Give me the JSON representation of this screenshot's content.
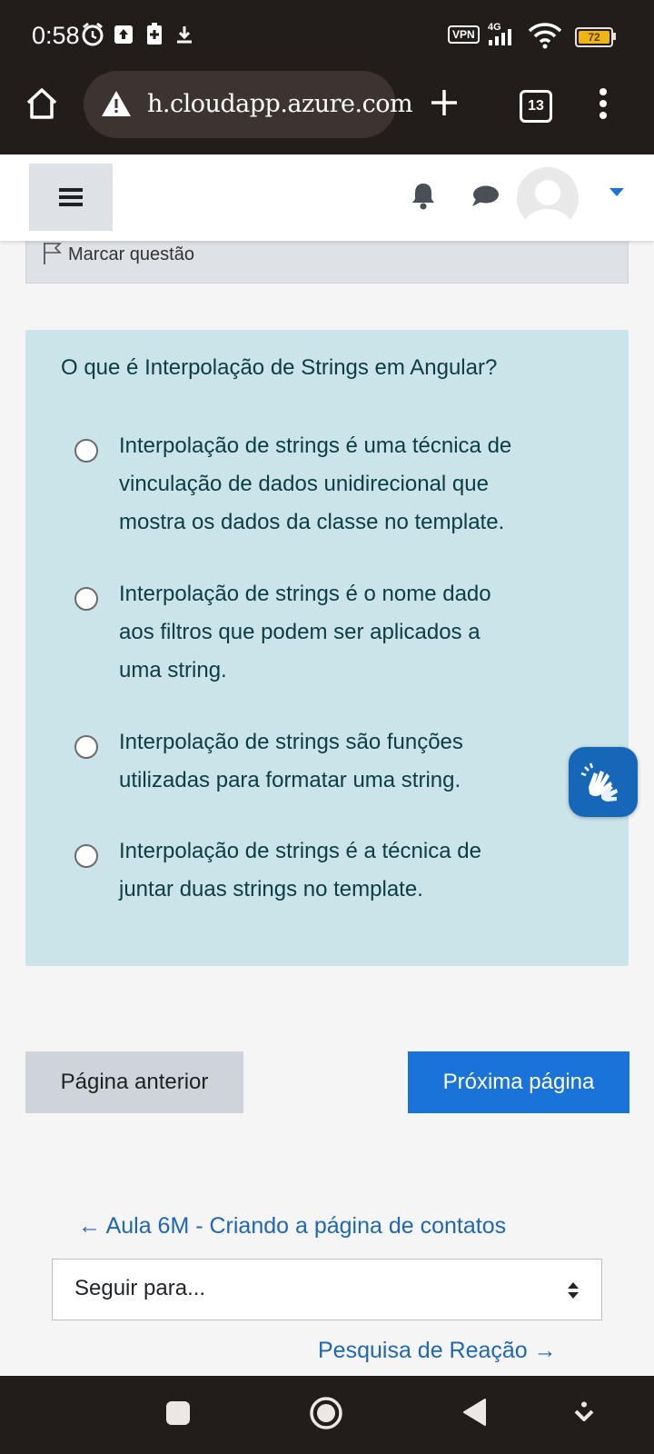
{
  "status_bar": {
    "time": "0:58",
    "vpn": "VPN",
    "network": "4G",
    "battery_level": "72",
    "icons": [
      "alarm-icon",
      "upload-icon",
      "battery-saver-icon",
      "download-icon",
      "signal-icon",
      "wifi-icon"
    ]
  },
  "browser": {
    "url": "h.cloudapp.azure.com",
    "tab_count": "13",
    "icons": [
      "home-icon",
      "warning-icon",
      "new-tab-icon",
      "tabs-icon",
      "menu-dots-icon"
    ]
  },
  "header": {
    "icons": [
      "hamburger-icon",
      "bell-icon",
      "chat-icon",
      "avatar",
      "caret-down-icon"
    ]
  },
  "question": {
    "flag_label": "Marcar questão",
    "text": "O que é Interpolação de Strings em Angular?",
    "options": [
      {
        "lines": [
          "Interpolação de strings é uma técnica de",
          "vinculação de dados unidirecional que",
          "mostra os dados da classe no template."
        ]
      },
      {
        "lines": [
          "Interpolação de strings é o nome dado",
          "aos filtros que podem ser aplicados a",
          "uma string."
        ]
      },
      {
        "lines": [
          "Interpolação de strings são funções",
          "utilizadas para formatar uma string."
        ]
      },
      {
        "lines": [
          "Interpolação de strings é a técnica de",
          "juntar duas strings no template."
        ]
      }
    ]
  },
  "navigation": {
    "prev_page": "Página anterior",
    "next_page": "Próxima página",
    "prev_activity": "← Aula 6M - Criando a página de contatos",
    "jump_to": "Seguir para...",
    "next_activity": "Pesquisa de Reação →"
  },
  "colors": {
    "question_bg": "#cae4ea",
    "primary": "#1a73d9",
    "link": "#1f67b3",
    "system_bar": "#221d1b"
  }
}
